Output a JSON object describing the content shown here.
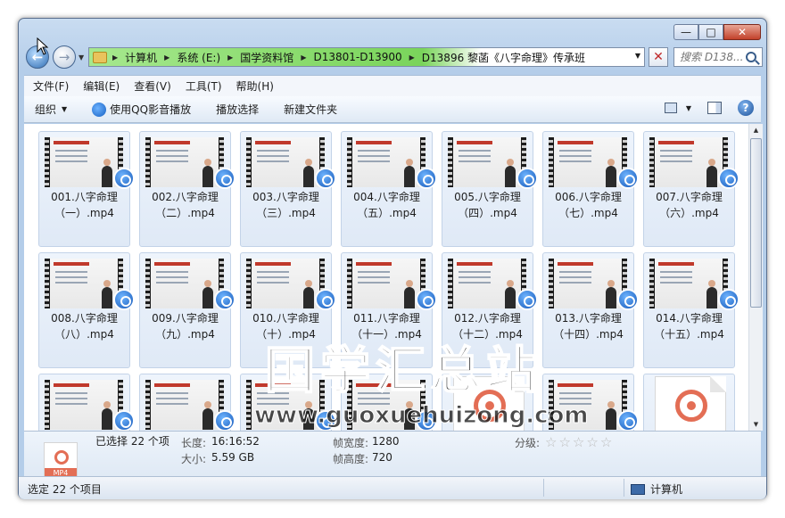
{
  "window": {
    "buttons": {
      "minimize": "—",
      "maximize": "□",
      "close": "✕"
    }
  },
  "nav": {
    "back": "←",
    "forward": "→"
  },
  "address": {
    "crumbs": [
      "计算机",
      "系统 (E:)",
      "国学资料馆",
      "D13801-D13900",
      "D13896 黎菡《八字命理》传承班"
    ],
    "clear": "✕"
  },
  "search": {
    "placeholder": "搜索 D138..."
  },
  "menu": [
    "文件(F)",
    "编辑(E)",
    "查看(V)",
    "工具(T)",
    "帮助(H)"
  ],
  "toolbar": {
    "organize": "组织",
    "play_qq": "使用QQ影音播放",
    "play_selection": "播放选择",
    "new_folder": "新建文件夹",
    "help": "?"
  },
  "files": [
    "001.八字命理（一）.mp4",
    "002.八字命理（二）.mp4",
    "003.八字命理（三）.mp4",
    "004.八字命理（五）.mp4",
    "005.八字命理（四）.mp4",
    "006.八字命理（七）.mp4",
    "007.八字命理（六）.mp4",
    "008.八字命理（八）.mp4",
    "009.八字命理（九）.mp4",
    "010.八字命理（十）.mp4",
    "011.八字命理（十一）.mp4",
    "012.八字命理（十二）.mp4",
    "013.八字命理（十四）.mp4",
    "014.八字命理（十五）.mp4"
  ],
  "row3_tiles": [
    "video",
    "video",
    "video",
    "video",
    "mp4",
    "video",
    "mp4"
  ],
  "mp4_badge": "MP4",
  "watermark": {
    "title": "国学汇总站",
    "url": "www.guoxuehuizong.com"
  },
  "details": {
    "icon_label": "MP4",
    "selected": "已选择 22 个项",
    "length_label": "长度:",
    "length_value": "16:16:52",
    "size_label": "大小:",
    "size_value": "5.59 GB",
    "width_label": "帧宽度:",
    "width_value": "1280",
    "height_label": "帧高度:",
    "height_value": "720",
    "rating_label": "分级:",
    "rating_stars": 0
  },
  "status": {
    "left": "选定 22 个项目",
    "right": "计算机"
  },
  "colors": {
    "accent": "#1457b8",
    "mp4": "#e36e55",
    "address_progress": "#7ad45b"
  }
}
